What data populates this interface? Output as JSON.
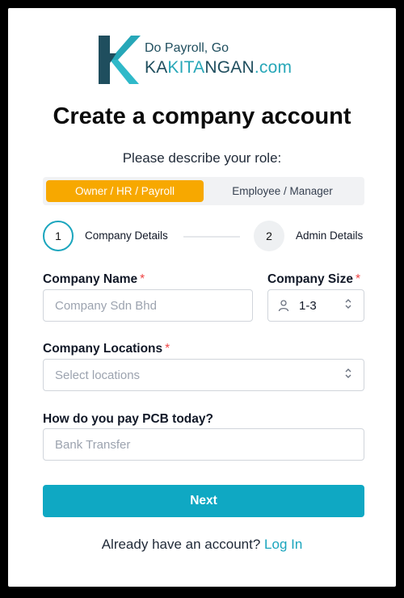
{
  "logo": {
    "tagline": "Do Payroll, Go",
    "brand_part1": "KA",
    "brand_part2": "KITA",
    "brand_part3": "NGAN",
    "brand_part4": ".com",
    "colors": {
      "dark": "#1f4e5e",
      "teal": "#27a7b8"
    }
  },
  "title": "Create a company account",
  "role_prompt": "Please describe your role:",
  "roles": [
    {
      "label": "Owner / HR / Payroll",
      "selected": true
    },
    {
      "label": "Employee / Manager",
      "selected": false
    }
  ],
  "stepper": {
    "steps": [
      {
        "number": "1",
        "label": "Company Details",
        "active": true
      },
      {
        "number": "2",
        "label": "Admin Details",
        "active": false
      }
    ]
  },
  "form": {
    "company_name": {
      "label": "Company Name",
      "required_mark": "*",
      "placeholder": "Company Sdn Bhd",
      "icon": "none"
    },
    "company_size": {
      "label": "Company Size",
      "required_mark": "*",
      "value": "1-3",
      "icon": "user-icon"
    },
    "company_locations": {
      "label": "Company Locations",
      "required_mark": "*",
      "placeholder": "Select locations"
    },
    "pcb_payment": {
      "label": "How do you pay PCB today?",
      "placeholder": "Bank Transfer"
    }
  },
  "next_label": "Next",
  "footer": {
    "text": "Already have an account?",
    "link": "Log In"
  },
  "colors": {
    "accent": "#0fa8c3",
    "role_active": "#f7a800",
    "required": "#ef4444"
  }
}
